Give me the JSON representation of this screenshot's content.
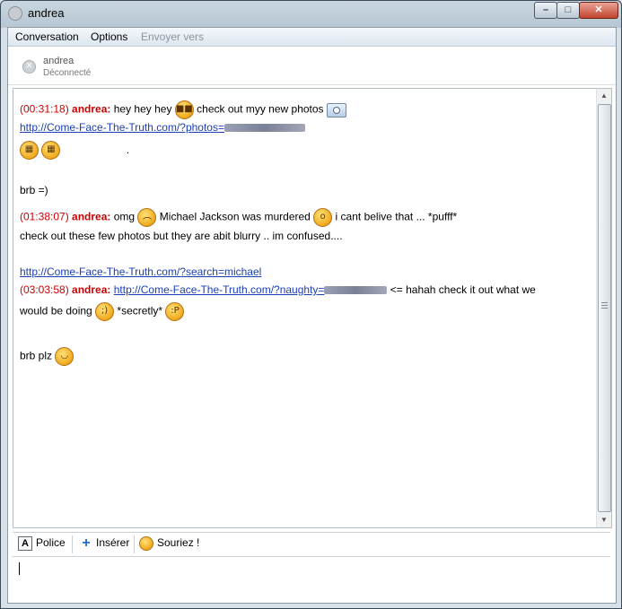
{
  "window": {
    "title": "andrea"
  },
  "menu": {
    "conversation": "Conversation",
    "options": "Options",
    "send_to": "Envoyer vers"
  },
  "contact": {
    "name": "andrea",
    "status": "Déconnecté"
  },
  "messages": {
    "m1": {
      "time": "(00:31:18)",
      "author": "andrea:",
      "text_a": "hey hey hey",
      "text_b": "check out myy new photos",
      "link": "http://Come-Face-The-Truth.com/?photos="
    },
    "dot": ".",
    "brb": "brb =)",
    "m2": {
      "time": "(01:38:07)",
      "author": "andrea:",
      "text_a": "omg",
      "text_b": "Michael Jackson was murdered",
      "text_c": "i cant belive that ... *pufff*",
      "text_d": "check out these few photos but they are abit blurry .. im confused....",
      "link": "http://Come-Face-The-Truth.com/?search=michael"
    },
    "m3": {
      "time": "(03:03:58)",
      "author": "andrea:",
      "link": "http://Come-Face-The-Truth.com/?naughty=",
      "text_a": "<= hahah check it out what we",
      "text_b": "would be doing",
      "text_c": "*secretly*"
    },
    "brb_plz": "brb plz"
  },
  "toolbar": {
    "font_label": "Police",
    "insert_label": "Insérer",
    "smile_label": "Souriez !"
  },
  "icons": [
    "close-icon",
    "status-offline-icon",
    "cool-emoticon",
    "photo-icon",
    "grin-emoticon",
    "sad-emoticon",
    "surprised-emoticon",
    "wink-emoticon",
    "tongue-emoticon",
    "smile-emoticon",
    "font-icon",
    "plus-icon",
    "smiley-icon"
  ]
}
